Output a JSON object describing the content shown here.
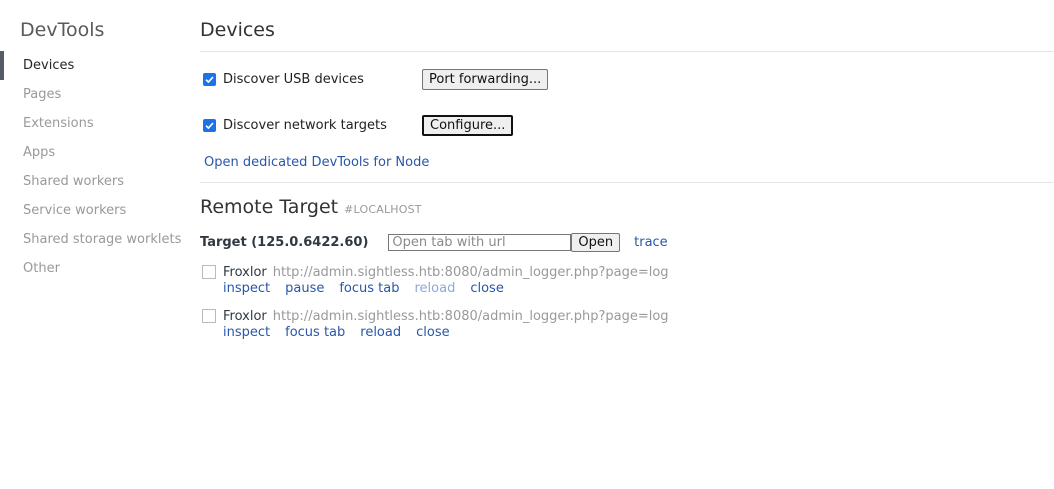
{
  "app": {
    "title": "DevTools"
  },
  "sidebar": {
    "items": [
      {
        "label": "Devices",
        "selected": true
      },
      {
        "label": "Pages"
      },
      {
        "label": "Extensions"
      },
      {
        "label": "Apps"
      },
      {
        "label": "Shared workers"
      },
      {
        "label": "Service workers"
      },
      {
        "label": "Shared storage worklets"
      },
      {
        "label": "Other"
      }
    ]
  },
  "devices": {
    "title": "Devices",
    "usb": {
      "label": "Discover USB devices",
      "checked": true,
      "button": "Port forwarding..."
    },
    "network": {
      "label": "Discover network targets",
      "checked": true,
      "button": "Configure..."
    },
    "node_link": "Open dedicated DevTools for Node"
  },
  "remote": {
    "title": "Remote Target",
    "subtitle": "#LOCALHOST",
    "target_label": "Target (125.0.6422.60)",
    "url_placeholder": "Open tab with url",
    "open_button": "Open",
    "trace_link": "trace",
    "pages": [
      {
        "name": "Froxlor",
        "url": "http://admin.sightless.htb:8080/admin_logger.php?page=log",
        "actions": {
          "inspect": "inspect",
          "pause": "pause",
          "focus": "focus tab",
          "reload": "reload",
          "close": "close"
        }
      },
      {
        "name": "Froxlor",
        "url": "http://admin.sightless.htb:8080/admin_logger.php?page=log",
        "actions": {
          "inspect": "inspect",
          "focus": "focus tab",
          "reload": "reload",
          "close": "close"
        }
      }
    ]
  },
  "colors": {
    "accent": "#1a73e8",
    "link": "#2a56a8",
    "selected_bar": "#555c66"
  }
}
